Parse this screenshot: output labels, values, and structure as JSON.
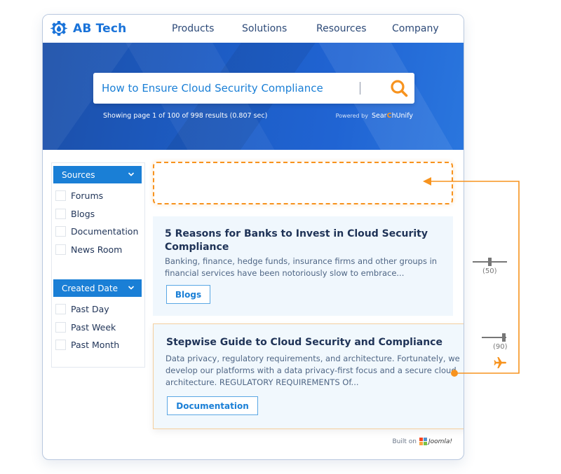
{
  "navbar": {
    "brand": "AB Tech",
    "items": [
      "Products",
      "Solutions",
      "Resources",
      "Company"
    ]
  },
  "search": {
    "query": "How to Ensure Cloud Security Compliance",
    "placeholder": "",
    "stats": "Showing page 1 of 100 of 998 results (0.807 sec)",
    "powered_by": "Powered by",
    "powered_brand_a": "Sear",
    "powered_brand_c": "C",
    "powered_brand_b": "hUnify",
    "icons": {
      "search": "search-icon"
    }
  },
  "facets": [
    {
      "title": "Sources",
      "options": [
        "Forums",
        "Blogs",
        "Documentation",
        "News Room"
      ]
    },
    {
      "title": "Created Date",
      "options": [
        "Past Day",
        "Past Week",
        "Past Month"
      ]
    }
  ],
  "results": [
    {
      "title": "5 Reasons for Banks to Invest in Cloud Security Compliance",
      "snippet": "Banking, finance, hedge funds, insurance firms and other groups in financial services have been notoriously slow to embrace...",
      "tag": "Blogs"
    },
    {
      "title": "Stepwise Guide to Cloud Security and Compliance",
      "snippet": "Data privacy, regulatory requirements, and architecture. Fortunately, we develop our platforms with a data privacy-first focus and a secure cloud architecture. REGULATORY REQUIREMENTS Of...",
      "tag": "Documentation"
    }
  ],
  "sliders": [
    {
      "value": 50,
      "label": "(50)"
    },
    {
      "value": 90,
      "label": "(90)"
    }
  ],
  "footer": {
    "built_on": "Built on",
    "platform": "Joomla!"
  },
  "colors": {
    "accent": "#1a7fd6",
    "orange": "#f7931e",
    "hero": "#1d5cc4"
  }
}
